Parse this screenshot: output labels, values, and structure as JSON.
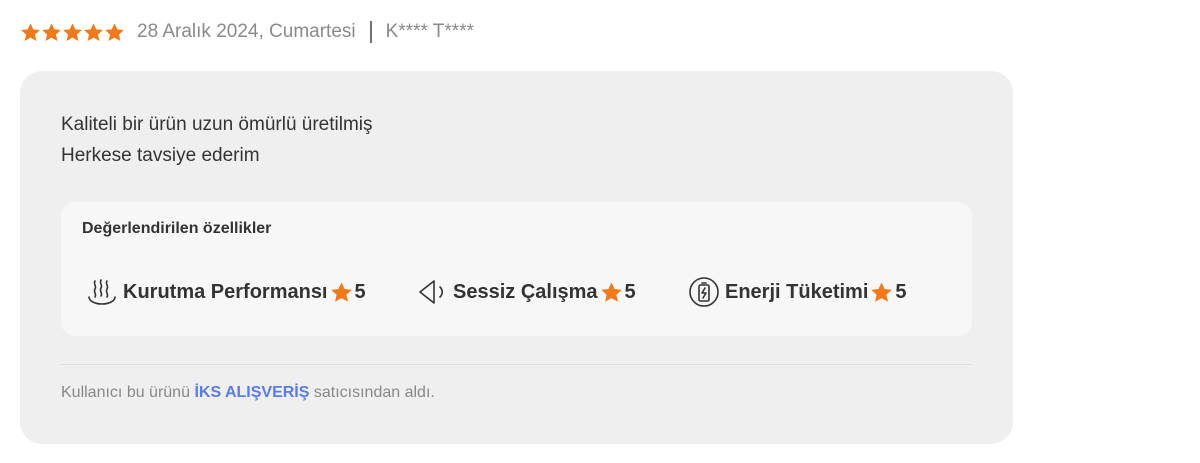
{
  "review": {
    "rating": 5,
    "rating_max": 5,
    "date": "28 Aralık 2024, Cumartesi",
    "author": "K**** T****",
    "comment_lines": [
      "Kaliteli bir ürün uzun ömürlü üretilmiş",
      "Herkese tavsiye ederim"
    ]
  },
  "features": {
    "title": "Değerlendirilen özellikler",
    "items": [
      {
        "label": "Kurutma Performansı",
        "score": "5",
        "icon": "steam-icon"
      },
      {
        "label": "Sessiz Çalışma",
        "score": "5",
        "icon": "speaker-icon"
      },
      {
        "label": "Enerji Tüketimi",
        "score": "5",
        "icon": "battery-icon"
      }
    ]
  },
  "seller": {
    "prefix": "Kullanıcı bu ürünü",
    "name": "İKS ALIŞVERİŞ",
    "suffix": "satıcısından aldı."
  },
  "colors": {
    "star": "#f27a1a",
    "seller_link": "#5b7be6",
    "card_bg": "#efefef",
    "features_bg": "#f7f7f7"
  }
}
